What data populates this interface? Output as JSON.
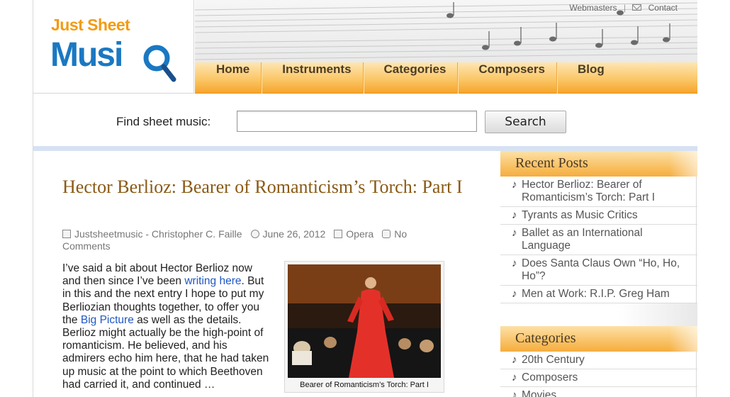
{
  "logo": {
    "top_text": "Just Sheet",
    "bottom_text": "Musi"
  },
  "top_links": {
    "webmasters": "Webmasters",
    "separator": "|",
    "contact": "Contact"
  },
  "nav": {
    "items": [
      "Home",
      "Instruments",
      "Categories",
      "Composers",
      "Blog"
    ]
  },
  "search": {
    "label": "Find sheet music:",
    "placeholder": "",
    "button": "Search"
  },
  "post": {
    "title": "Hector Berlioz: Bearer of Romanticism’s Torch: Part I",
    "author": "Justsheetmusic - Christopher C. Faille",
    "date": "June 26, 2012",
    "category": "Opera",
    "comments": "No Comments",
    "body": {
      "p1": "I’ve said a bit about Hector Berlioz now and then since I’ve been ",
      "link1": "writing here",
      "p2": ". But in this and the next entry I hope to put my Berliozian thoughts together, to offer you the ",
      "link2": "Big Picture",
      "p3": " as well as the details. Berlioz might actually be the high-point of romanticism. He believed, and his admirers echo him here, that he had taken up music at the point to which Beethoven had carried it, and continued …"
    },
    "image_caption": "Bearer of Romanticism’s Torch: Part I"
  },
  "sidebar": {
    "recent_posts": {
      "heading": "Recent Posts",
      "items": [
        "Hector Berlioz: Bearer of Romanticism’s Torch: Part I",
        "Tyrants as Music Critics",
        "Ballet as an International Language",
        "Does Santa Claus Own “Ho, Ho, Ho”?",
        "Men at Work: R.I.P. Greg Ham"
      ]
    },
    "categories": {
      "heading": "Categories",
      "items": [
        "20th Century",
        "Composers",
        "Movies"
      ]
    }
  },
  "colors": {
    "accent_orange": "#f39b12",
    "logo_blue": "#1a78c2",
    "title_brown": "#8a5a14",
    "link_blue": "#1f57c3"
  }
}
